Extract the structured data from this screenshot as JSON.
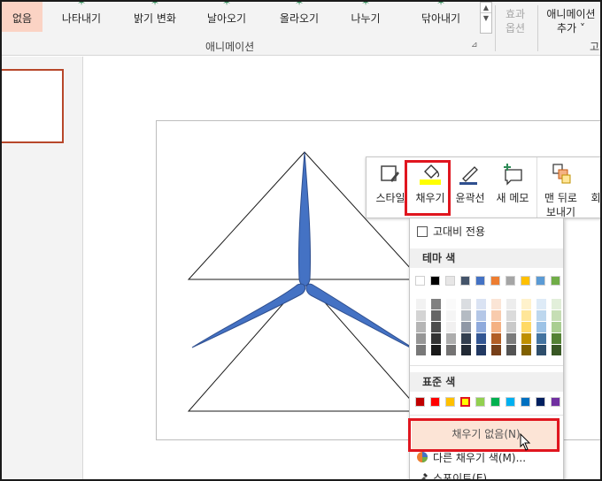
{
  "ribbon": {
    "animations": [
      {
        "label": "없음",
        "selected": true
      },
      {
        "label": "나타내기",
        "selected": false
      },
      {
        "label": "밝기 변화",
        "selected": false
      },
      {
        "label": "날아오기",
        "selected": false
      },
      {
        "label": "올라오기",
        "selected": false
      },
      {
        "label": "나누기",
        "selected": false
      },
      {
        "label": "닦아내기",
        "selected": false
      }
    ],
    "effect_options_line1": "효과",
    "effect_options_line2": "옵션",
    "add_animation_line1": "애니메이션",
    "add_animation_line2": "추가",
    "group_label": "애니메이션",
    "group_label_next": "고"
  },
  "mini_toolbar": {
    "style_label": "스타일",
    "fill_label": "채우기",
    "outline_label": "윤곽선",
    "new_comment_label": "새 메모",
    "send_back_line1": "맨 뒤로",
    "send_back_line2": "보내기",
    "cut_off_label": "회"
  },
  "fill_menu": {
    "high_contrast_label": "고대비 전용",
    "theme_colors_heading": "테마 색",
    "standard_colors_heading": "표준 색",
    "no_fill_label": "채우기 없음(N)",
    "more_colors_label": "다른 채우기 색(M)...",
    "eyedropper_label": "스포이트(E)",
    "theme_colors": [
      "#ffffff",
      "#000000",
      "#e7e6e6",
      "#44546a",
      "#4472c4",
      "#ed7d31",
      "#a5a5a5",
      "#ffc000",
      "#5b9bd5",
      "#70ad47"
    ],
    "standard_colors": [
      "#c00000",
      "#ff0000",
      "#ffc000",
      "#ffff00",
      "#92d050",
      "#00b050",
      "#00b0f0",
      "#0070c0",
      "#002060",
      "#7030a0"
    ],
    "selected_standard_color": "#ffff00"
  },
  "colors": {
    "highlight_red": "#e0161f",
    "thumbnail_border": "#b7472a",
    "blade_fill": "#4472c4",
    "blade_outline": "#2f4f8f",
    "selected_animation_bg": "#fbd3c4"
  }
}
